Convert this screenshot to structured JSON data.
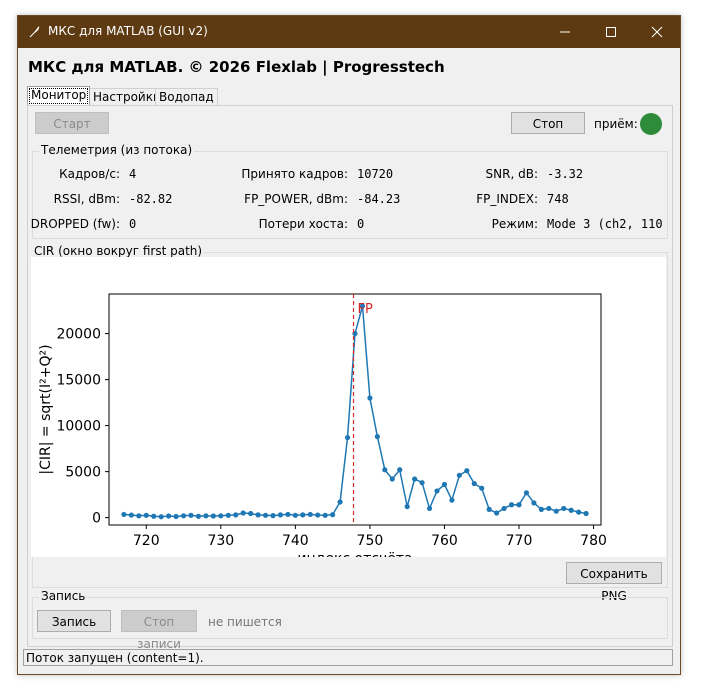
{
  "window": {
    "title": "МКС для MATLAB  (GUI v2)",
    "titlebar_color": "#5e3a12",
    "icons": [
      "feather-icon",
      "minimize-icon",
      "maximize-icon",
      "close-icon"
    ]
  },
  "app": {
    "heading": "МКС для MATLAB. © 2026 Flexlab | Progresstech"
  },
  "tabs": [
    {
      "label": "Монитор",
      "active": true
    },
    {
      "label": "Настройки",
      "active": false
    },
    {
      "label": "Водопад",
      "active": false
    }
  ],
  "controls": {
    "start_label": "Старт",
    "stop_label": "Стоп",
    "rx_label": "приём:",
    "rx_indicator_color": "#2e8b3a"
  },
  "telemetry": {
    "title": "Телеметрия (из потока)",
    "frames_per_sec_label": "Кадров/с:",
    "frames_per_sec_value": "4",
    "frames_received_label": "Принято кадров:",
    "frames_received_value": "10720",
    "snr_label": "SNR, dB:",
    "snr_value": "-3.32",
    "rssi_label": "RSSI, dBm:",
    "rssi_value": "-82.82",
    "fp_power_label": "FP_POWER, dBm:",
    "fp_power_value": "-84.23",
    "fp_index_label": "FP_INDEX:",
    "fp_index_value": "748",
    "dropped_label": "DROPPED (fw):",
    "dropped_value": "0",
    "host_loss_label": "Потери хоста:",
    "host_loss_value": "0",
    "mode_label": "Режим:",
    "mode_value": "Mode 3 (ch2, 110"
  },
  "cir": {
    "title": "CIR (окно вокруг first path)",
    "save_png_label": "Сохранить PNG"
  },
  "chart_data": {
    "type": "line",
    "ylabel": "|CIR| = sqrt(I²+Q²)",
    "xlabel": "индекс отсчёта",
    "xlim": [
      715,
      781
    ],
    "ylim": [
      -800,
      24300
    ],
    "xticks": [
      720,
      730,
      740,
      750,
      760,
      770,
      780
    ],
    "yticks": [
      0,
      5000,
      10000,
      15000,
      20000
    ],
    "grid": false,
    "line_color": "#1f77b4",
    "marker_line_color": "#d62728",
    "marker_x": 747.8,
    "marker_label": "FP",
    "x": [
      717,
      718,
      719,
      720,
      721,
      722,
      723,
      724,
      725,
      726,
      727,
      728,
      729,
      730,
      731,
      732,
      733,
      734,
      735,
      736,
      737,
      738,
      739,
      740,
      741,
      742,
      743,
      744,
      745,
      746,
      747,
      748,
      749,
      750,
      751,
      752,
      753,
      754,
      755,
      756,
      757,
      758,
      759,
      760,
      761,
      762,
      763,
      764,
      765,
      766,
      767,
      768,
      769,
      770,
      771,
      772,
      773,
      774,
      775,
      776,
      777,
      778,
      779
    ],
    "values": [
      350,
      280,
      200,
      250,
      150,
      100,
      180,
      120,
      200,
      250,
      150,
      200,
      180,
      200,
      250,
      300,
      500,
      450,
      300,
      250,
      220,
      300,
      350,
      250,
      300,
      350,
      280,
      250,
      320,
      1700,
      8700,
      20000,
      23000,
      13000,
      8800,
      5200,
      4200,
      5200,
      1200,
      4200,
      3800,
      1000,
      2900,
      3600,
      1900,
      4600,
      5100,
      3700,
      3200,
      900,
      500,
      1000,
      1400,
      1400,
      2700,
      1600,
      900,
      1000,
      700,
      1000,
      800,
      600,
      450
    ]
  },
  "record": {
    "title": "Запись",
    "record_label": "Запись",
    "stop_record_label": "Стоп записи",
    "status": "не пишется"
  },
  "status_bar": {
    "text": "Поток запущен (content=1)."
  }
}
